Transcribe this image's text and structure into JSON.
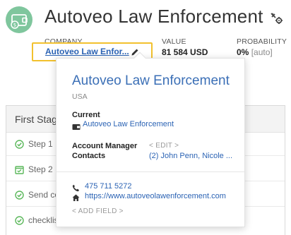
{
  "deal": {
    "title": "Autoveo Law Enforcement"
  },
  "fields": {
    "company_label": "COMPANY",
    "company_value": "Autoveo Law Enfor...",
    "value_label": "VALUE",
    "value_amount": "81 584 USD",
    "probability_label": "PROBABILITY",
    "probability_value": "0%",
    "probability_auto": "[auto]"
  },
  "stage": {
    "title": "First Stag",
    "activities": [
      {
        "label": "Step 1",
        "icon": "check-circle-icon"
      },
      {
        "label": "Step 2",
        "icon": "calendar-check-icon"
      },
      {
        "label": "Send co",
        "icon": "check-circle-icon"
      },
      {
        "label": "checklis",
        "icon": "check-circle-icon"
      }
    ]
  },
  "popover": {
    "title": "Autoveo Law Enforcement",
    "country": "USA",
    "current_label": "Current",
    "current_value": "Autoveo Law Enforcement",
    "account_manager_label": "Account Manager",
    "account_manager_value": "< EDIT >",
    "contacts_label": "Contacts",
    "contacts_value": "(2) John Penn, Nicole ...",
    "phone": "475 711 5272",
    "website": "https://www.autoveolawenforcement.com",
    "add_field": "< ADD FIELD >"
  },
  "colors": {
    "accent_link": "#2b63b4",
    "highlight_border": "#f2c12e",
    "deal_icon_bg": "#7fc69d",
    "check_green": "#5cb85c"
  }
}
